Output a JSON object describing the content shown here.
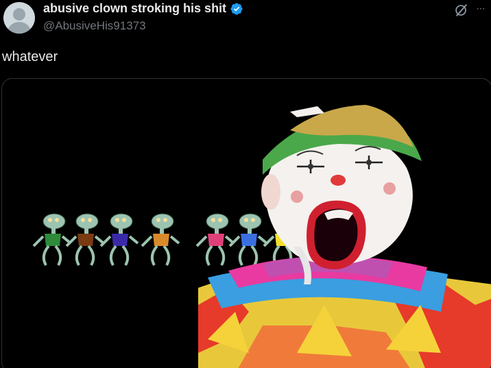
{
  "post": {
    "display_name": "abusive clown stroking his shit",
    "handle": "@AbusiveHis91373",
    "text": "whatever",
    "verified": true
  },
  "icons": {
    "avatar": "default-avatar-icon",
    "verified": "verified-badge-icon",
    "grok": "grok-icon",
    "more": "more-horizontal-icon"
  },
  "colors": {
    "background": "#000000",
    "text_primary": "#e7e9ea",
    "text_secondary": "#71767b",
    "verified_blue": "#1d9bf0",
    "media_border": "#2f3336"
  },
  "media": {
    "squidward_shirt_colors": [
      "#2e8b3a",
      "#7a3a12",
      "#3a2aa8",
      "#d98a2a",
      "#e0407a",
      "#3a6fe0",
      "#f2e02a",
      "#3a2ae0"
    ]
  }
}
